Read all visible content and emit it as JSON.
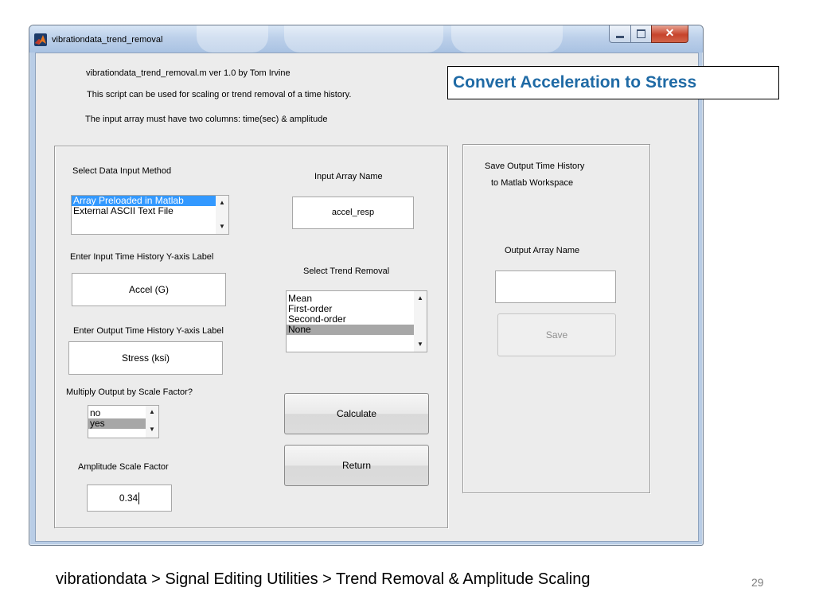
{
  "window": {
    "title": "vibrationdata_trend_removal"
  },
  "header": {
    "line1": "vibrationdata_trend_removal.m   ver 1.0  by Tom Irvine",
    "line2": "This script can be used for scaling or trend removal of a time history.",
    "line3": "The input array must have two columns: time(sec) & amplitude"
  },
  "left_panel": {
    "input_method_label": "Select Data Input Method",
    "input_method_options": [
      "Array Preloaded in Matlab",
      "External ASCII Text File"
    ],
    "input_method_selected": "Array Preloaded in Matlab",
    "array_name_label": "Input Array Name",
    "array_name_value": "accel_resp",
    "y_label_input_label": "Enter Input Time History Y-axis Label",
    "y_label_input_value": "Accel (G)",
    "trend_label": "Select Trend Removal",
    "trend_options": [
      "Mean",
      "First-order",
      "Second-order",
      "None"
    ],
    "trend_selected": "None",
    "y_label_output_label": "Enter Output Time History Y-axis Label",
    "y_label_output_value": "Stress (ksi)",
    "scale_factor_question": "Multiply Output by Scale Factor?",
    "scale_factor_options": [
      "no",
      "yes"
    ],
    "scale_factor_selected": "yes",
    "amplitude_label": "Amplitude Scale Factor",
    "amplitude_value": "0.34",
    "calculate_label": "Calculate",
    "return_label": "Return"
  },
  "right_panel": {
    "save_title_line1": "Save Output Time History",
    "save_title_line2": "to Matlab Workspace",
    "output_name_label": "Output Array Name",
    "output_name_value": "",
    "save_label": "Save"
  },
  "callout": "Convert Acceleration to Stress",
  "footer": {
    "breadcrumb": "vibrationdata > Signal Editing Utilities > Trend Removal & Amplitude Scaling",
    "page_number": "29"
  },
  "colors": {
    "callout_text": "#1f6aa5",
    "selection_blue": "#3399ff",
    "selection_gray": "#a7a7a7",
    "window_frame": "#b9cde6"
  },
  "icons": [
    "matlab-icon",
    "minimize-icon",
    "maximize-icon",
    "close-icon",
    "scroll-up-arrow-icon",
    "scroll-down-arrow-icon"
  ]
}
